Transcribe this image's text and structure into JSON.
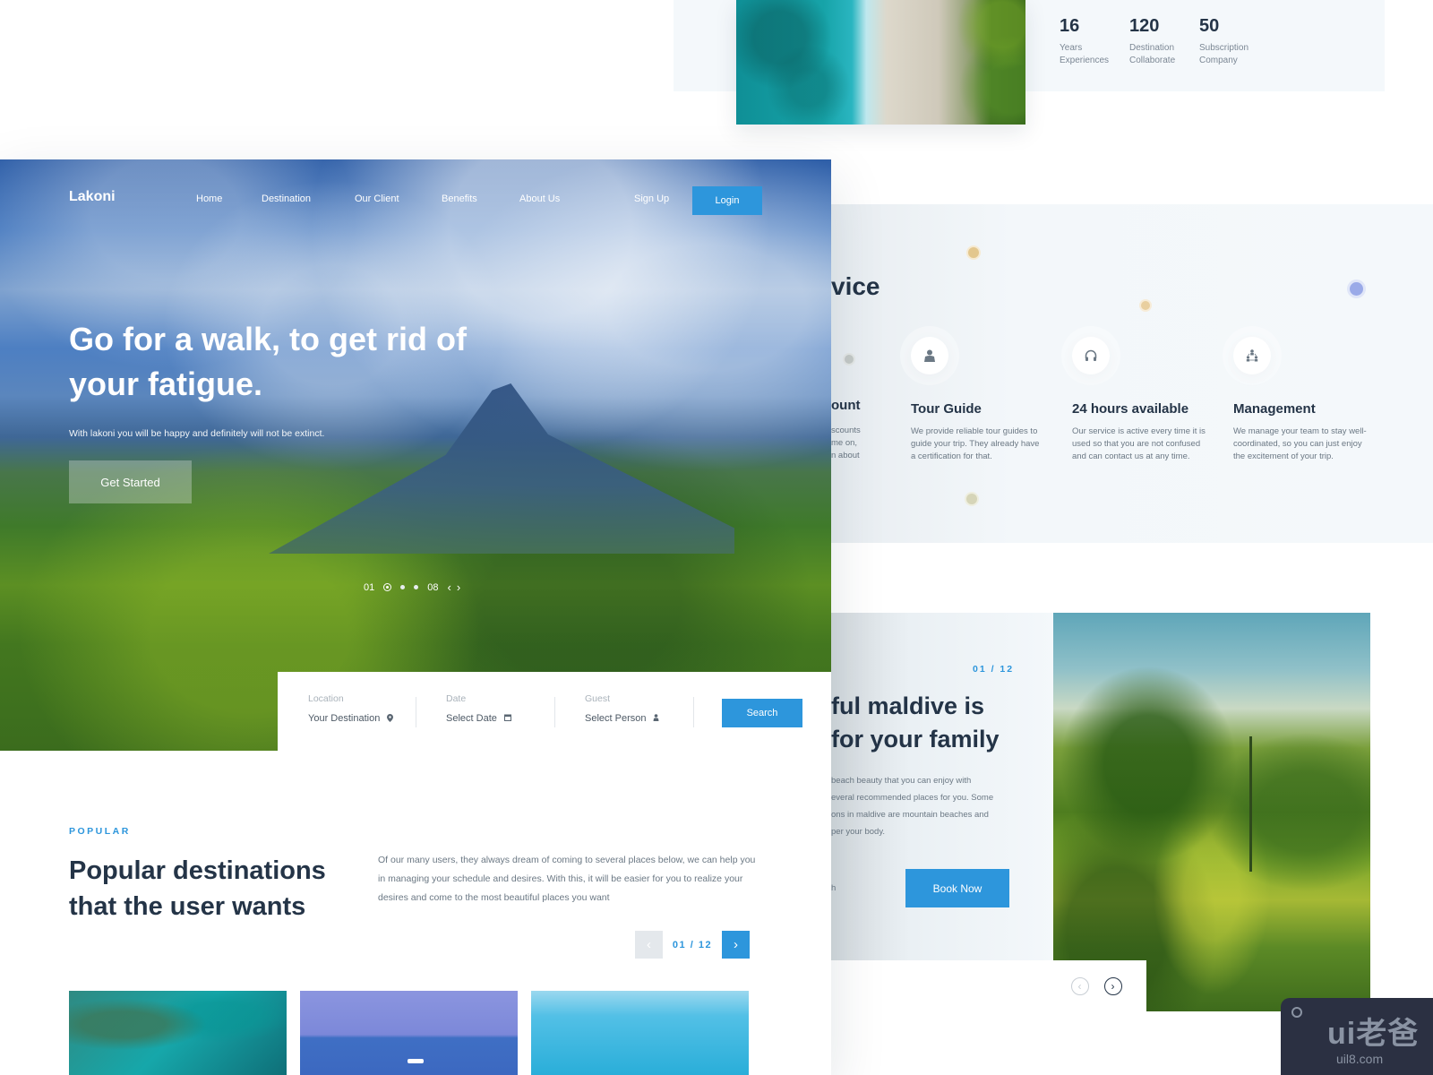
{
  "stats": [
    {
      "value": "16",
      "label_line1": "Years",
      "label_line2": "Experiences"
    },
    {
      "value": "120",
      "label_line1": "Destination",
      "label_line2": "Collaborate"
    },
    {
      "value": "50",
      "label_line1": "Subscription",
      "label_line2": "Company"
    }
  ],
  "services": {
    "title_visible": "vice",
    "cut_card": {
      "title_visible": "ount",
      "desc_lines_visible": [
        "scounts",
        "me on,",
        "n about"
      ]
    },
    "cards": [
      {
        "icon": "tour-guide-icon",
        "title": "Tour Guide",
        "description": "We provide reliable tour guides to guide your trip. They already have a certification for that."
      },
      {
        "icon": "headphones-icon",
        "title": "24 hours available",
        "description": "Our service is active every time it is used so that you are not confused and can contact us at any time."
      },
      {
        "icon": "team-management-icon",
        "title": "Management",
        "description": "We manage your team to stay well-coordinated, so you can just enjoy the excitement of your trip."
      }
    ]
  },
  "maldive": {
    "counter": "01 / 12",
    "title_line1": "ful maldive is",
    "title_line2": "for your family",
    "desc_lines": [
      "beach beauty that you can enjoy with",
      "everal recommended places for you. Some",
      "ons in maldive are mountain beaches and",
      "per your body."
    ],
    "extra_visible": "h",
    "book_label": "Book Now",
    "prev_icon": "‹",
    "next_icon": "›"
  },
  "hero": {
    "brand": "Lakoni",
    "nav_links": [
      "Home",
      "Destination",
      "Our Client",
      "Benefits",
      "About Us"
    ],
    "signup_label": "Sign Up",
    "login_label": "Login",
    "title": "Go for a walk, to get rid of your fatigue.",
    "subtitle": "With lakoni you will be happy and definitely will not be extinct.",
    "cta_label": "Get Started",
    "slider": {
      "current": "01",
      "total": "08",
      "prev_icon": "‹",
      "next_icon": "›"
    }
  },
  "search": {
    "location_label": "Location",
    "location_value": "Your Destination",
    "date_label": "Date",
    "date_value": "Select Date",
    "guest_label": "Guest",
    "guest_value": "Select Person",
    "button_label": "Search"
  },
  "popular": {
    "eyebrow": "POPULAR",
    "title": "Popular destinations that the user wants",
    "description": "Of our many users, they always dream of coming to several places below, we can help you in managing your schedule and desires. With this, it will be easier for you to realize your desires and come to the most beautiful places you want",
    "pager": {
      "count": "01 / 12",
      "prev_icon": "‹",
      "next_icon": "›"
    }
  },
  "watermark": {
    "logo": "ui老爸",
    "url": "uil8.com"
  },
  "colors": {
    "accent": "#2d96dc",
    "heading": "#243447",
    "body_text": "#6b7884",
    "panel_bg": "#f4f8fb"
  }
}
